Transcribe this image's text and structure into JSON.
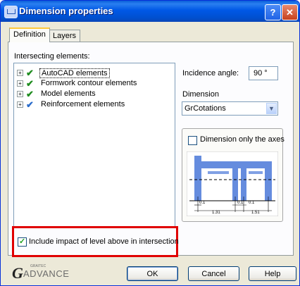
{
  "window": {
    "title": "Dimension properties",
    "help_glyph": "?",
    "close_glyph": "✕"
  },
  "tabs": [
    {
      "label": "Definition"
    },
    {
      "label": "Layers"
    }
  ],
  "definition": {
    "intersecting_label": "Intersecting elements:",
    "tree_items": [
      {
        "label": "AutoCAD elements",
        "icon": "green-check-icon",
        "selected": true
      },
      {
        "label": "Formwork contour elements",
        "icon": "green-check-icon"
      },
      {
        "label": "Model elements",
        "icon": "green-check-icon"
      },
      {
        "label": "Reinforcement elements",
        "icon": "blue-check-icon"
      }
    ],
    "incidence_label": "Incidence angle:",
    "incidence_value": "90 °",
    "dimension_label": "Dimension",
    "dimension_value": "GrCotations",
    "axes_only_label": "Dimension only the axes",
    "axes_only_checked": false,
    "preview_dims": {
      "d1": "0.1",
      "d2": "0.1",
      "d3": "0.1",
      "d4": "1.31",
      "d5": "1.51"
    },
    "include_label": "Include impact of level above in intersection",
    "include_checked": true
  },
  "buttons": {
    "ok": "OK",
    "cancel": "Cancel",
    "help": "Help"
  },
  "logo": {
    "text": "ADVANCE",
    "small": "GRAITEC",
    "glyph": "G"
  },
  "colors": {
    "title_bar": "#0058e6",
    "highlight": "#e00000",
    "preview_blue": "#4a78d8"
  }
}
